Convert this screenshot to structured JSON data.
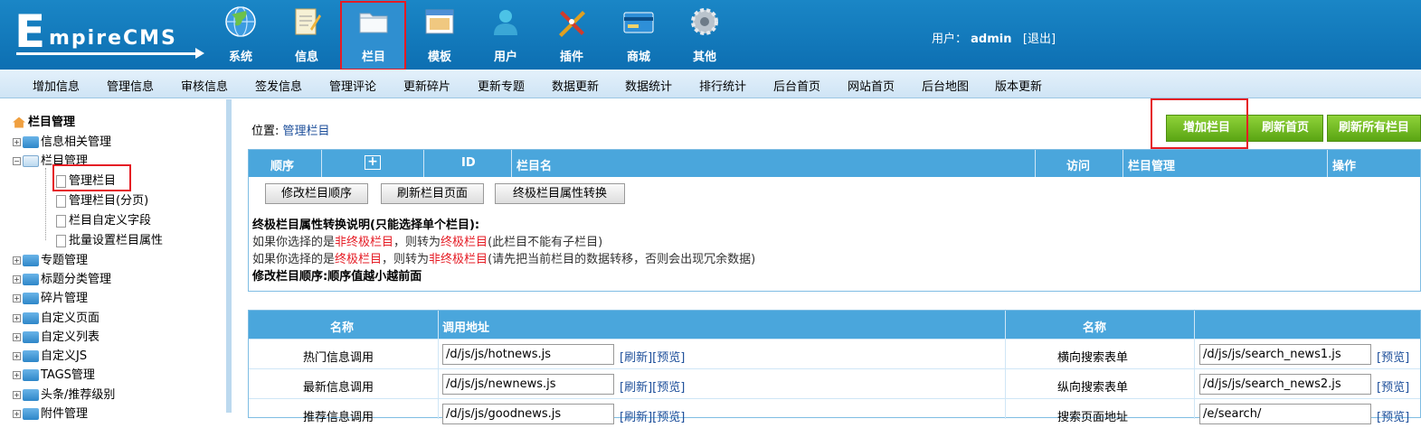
{
  "header": {
    "logo_text": "EmpireCMS",
    "user_label": "用户：",
    "username": "admin",
    "logout": "[退出]",
    "nav": [
      {
        "label": "系统",
        "icon": "globe-icon"
      },
      {
        "label": "信息",
        "icon": "notepad-icon"
      },
      {
        "label": "栏目",
        "icon": "folder-icon"
      },
      {
        "label": "模板",
        "icon": "window-template-icon"
      },
      {
        "label": "用户",
        "icon": "user-icon"
      },
      {
        "label": "插件",
        "icon": "tools-icon"
      },
      {
        "label": "商城",
        "icon": "card-icon"
      },
      {
        "label": "其他",
        "icon": "gear-icon"
      }
    ]
  },
  "submenu": [
    "增加信息",
    "管理信息",
    "审核信息",
    "签发信息",
    "管理评论",
    "更新碎片",
    "更新专题",
    "数据更新",
    "数据统计",
    "排行统计",
    "后台首页",
    "网站首页",
    "后台地图",
    "版本更新"
  ],
  "sidebar": {
    "title": "栏目管理",
    "items": [
      {
        "label": "信息相关管理",
        "expand": "+"
      },
      {
        "label": "栏目管理",
        "expand": "−"
      },
      {
        "label": "管理栏目"
      },
      {
        "label": "管理栏目(分页)"
      },
      {
        "label": "栏目自定义字段"
      },
      {
        "label": "批量设置栏目属性"
      },
      {
        "label": "专题管理",
        "expand": "+"
      },
      {
        "label": "标题分类管理",
        "expand": "+"
      },
      {
        "label": "碎片管理",
        "expand": "+"
      },
      {
        "label": "自定义页面",
        "expand": "+"
      },
      {
        "label": "自定义列表",
        "expand": "+"
      },
      {
        "label": "自定义JS",
        "expand": "+"
      },
      {
        "label": "TAGS管理",
        "expand": "+"
      },
      {
        "label": "头条/推荐级别",
        "expand": "+"
      },
      {
        "label": "附件管理",
        "expand": "+"
      }
    ]
  },
  "main": {
    "position_label": "位置:",
    "position_link": "管理栏目",
    "buttons": {
      "add": "增加栏目",
      "refresh_home": "刷新首页",
      "refresh_all": "刷新所有栏目"
    },
    "table1": {
      "headers": [
        "顺序",
        "+",
        "ID",
        "栏目名",
        "访问",
        "栏目管理",
        "操作"
      ],
      "actions": [
        "修改栏目顺序",
        "刷新栏目页面",
        "终极栏目属性转换"
      ],
      "notes": {
        "title": "终极栏目属性转换说明(只能选择单个栏目):",
        "l1a": "如果你选择的是",
        "l1b": "非终极栏目",
        "l1c": "，则转为",
        "l1d": "终极栏目",
        "l1e": "(此栏目不能有子栏目)",
        "l2a": "如果你选择的是",
        "l2b": "终极栏目",
        "l2c": "，则转为",
        "l2d": "非终极栏目",
        "l2e": "(请先把当前栏目的数据转移，否则会出现冗余数据)",
        "l3": "修改栏目顺序:顺序值越小越前面"
      }
    },
    "table2": {
      "headers": [
        "名称",
        "调用地址",
        "名称",
        ""
      ],
      "rows": [
        {
          "name": "热门信息调用",
          "path": "/d/js/js/hotnews.js",
          "links": "[刷新][预览]",
          "name2": "横向搜索表单",
          "path2": "/d/js/js/search_news1.js",
          "link2": "[预览]"
        },
        {
          "name": "最新信息调用",
          "path": "/d/js/js/newnews.js",
          "links": "[刷新][预览]",
          "name2": "纵向搜索表单",
          "path2": "/d/js/js/search_news2.js",
          "link2": "[预览]"
        },
        {
          "name": "推荐信息调用",
          "path": "/d/js/js/goodnews.js",
          "links": "[刷新][预览]",
          "name2": "搜索页面地址",
          "path2": "/e/search/",
          "link2": "[预览]"
        }
      ]
    }
  },
  "colors": {
    "header_blue": "#1a86c6",
    "table_header": "#4aa6dc",
    "green_button": "#5aa513",
    "highlight_red": "#e51b24"
  }
}
